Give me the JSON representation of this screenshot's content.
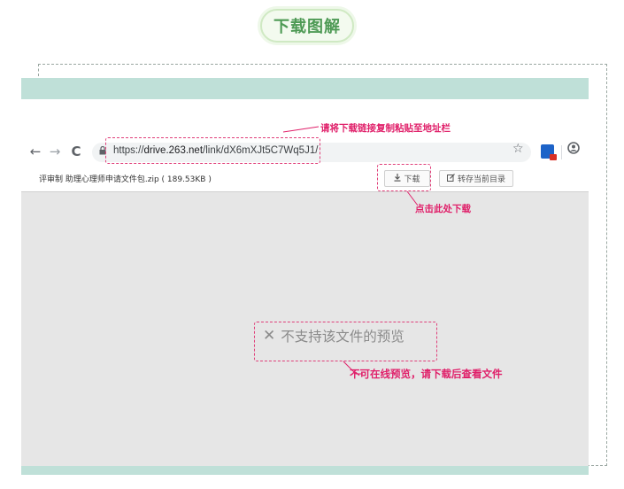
{
  "header": {
    "title": "下载图解"
  },
  "browser": {
    "url_scheme": "https://",
    "url_host": "drive.263.net",
    "url_path": "/link/dX6mXJt5C7Wq5J1/",
    "back_glyph": "←",
    "forward_glyph": "→",
    "reload_glyph": "C",
    "icons": [
      "back-arrow-icon",
      "forward-arrow-icon",
      "reload-icon",
      "lock-icon",
      "star-icon",
      "extension-icon",
      "profile-icon"
    ]
  },
  "file": {
    "name": "评审制 助理心理师申请文件包.zip ( 189.53KB )",
    "download_label": "下载",
    "save_label": "转存当前目录"
  },
  "preview": {
    "message": "不支持该文件的预览"
  },
  "annotations": {
    "paste_url": "请将下载链接复制粘贴至地址栏",
    "click_download": "点击此处下载",
    "no_preview_hint": "不可在线预览，请下载后查看文件"
  },
  "colors": {
    "accent_pink": "#e0206a",
    "teal_band": "#bfe0d8",
    "title_green": "#4e9a55"
  }
}
